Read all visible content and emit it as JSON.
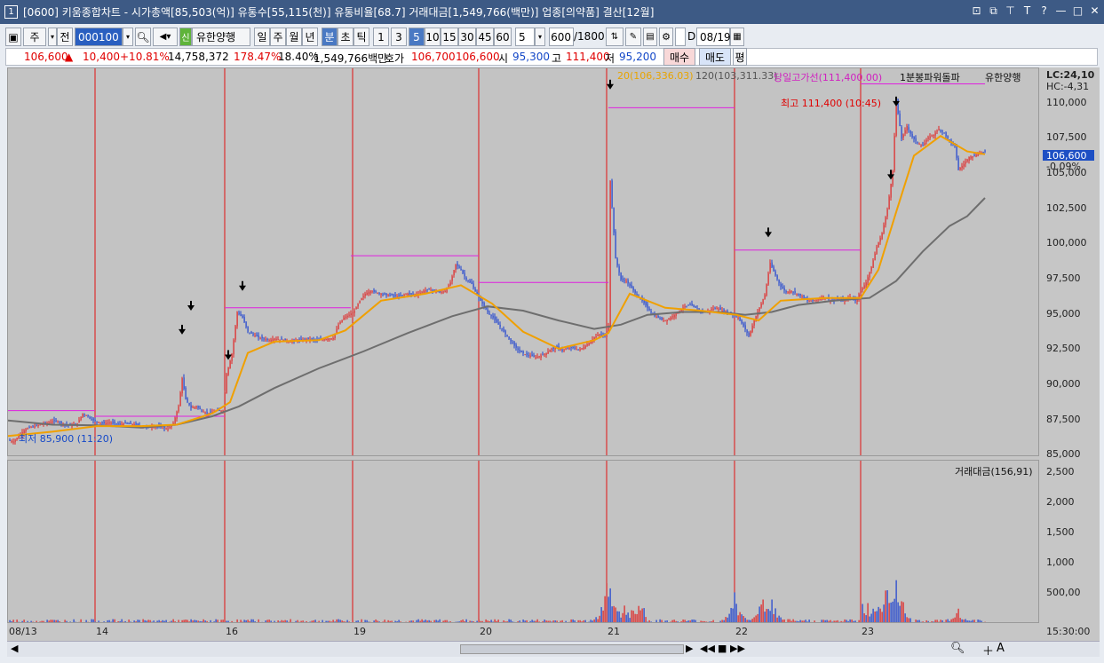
{
  "window": {
    "icon": "1",
    "title": "[0600] 키움종합차트 - 시가총액[85,503(억)] 유통수[55,115(천)] 유통비율[68.7] 거래대금[1,549,766(백만)] 업종[의약품] 결산[12월]",
    "buttons": [
      "⊡",
      "⧉",
      "⊤",
      "T",
      "?",
      "—",
      "□",
      "✕"
    ]
  },
  "toolbar": {
    "period": "주",
    "prev": "전",
    "code": "000100",
    "stock_name": "유한양행",
    "stock_badge": "신",
    "period_tabs": [
      "일",
      "주",
      "월",
      "년",
      "분",
      "초",
      "틱"
    ],
    "active_period": "분",
    "intervals": [
      "1",
      "3",
      "5",
      "10",
      "15",
      "30",
      "45",
      "60"
    ],
    "active_interval": "5",
    "interval_select": "5",
    "count": "600",
    "count_max": "/1800",
    "checkbox_label": "D",
    "date": "08/19"
  },
  "quote": {
    "price": "106,600",
    "arrow": "▲",
    "change": "10,400",
    "change_pct": "+10.81%",
    "volume": "14,758,372",
    "vol_ratio": "178.47%",
    "turnover": "18.40%",
    "amount": "1,549,766백만",
    "ask_label": "호가",
    "ask1": "106,700",
    "ask2": "106,600",
    "open_label": "시",
    "open": "95,300",
    "high_label": "고",
    "high": "111,400",
    "low_label": "저",
    "low": "95,200",
    "buy": "매수",
    "sell": "매도",
    "avg": "평"
  },
  "legend": {
    "ma20": "20(106,336.03)",
    "ma120": "120(103,311.33)",
    "high_line": "당일고가선(111,400.00)",
    "signal": "1분봉파워돌파",
    "name": "유한양행",
    "lc": "LC:24,10",
    "hc": "HC:-4,31",
    "max_note": "최고 111,400 (10:45)",
    "min_note": "최저 85,900 (11:20)",
    "volume": "거래대금(156,91)",
    "current_price": "106,600",
    "current_pct": "-0.09%"
  },
  "chart_data": {
    "type": "candlestick",
    "price_ticks": [
      "110,000",
      "107,500",
      "105,000",
      "102,500",
      "100,000",
      "97,500",
      "95,000",
      "92,500",
      "90,000",
      "87,500",
      "85,000"
    ],
    "price_values": [
      110000,
      107500,
      105000,
      102500,
      100000,
      97500,
      95000,
      92500,
      90000,
      87500,
      85000
    ],
    "ylim": [
      84900,
      112500
    ],
    "vol_ticks": [
      "2,500",
      "2,000",
      "1,500",
      "1,000",
      "500,00"
    ],
    "vol_values": [
      2500,
      2000,
      1500,
      1000,
      500
    ],
    "vol_lim": [
      0,
      2700
    ],
    "x_labels": [
      "08/13",
      "14",
      "16",
      "19",
      "20",
      "21",
      "22",
      "23"
    ],
    "time_label": "15:30:00",
    "close_series": [
      [
        0,
        86100
      ],
      [
        6,
        86000
      ],
      [
        12,
        86400
      ],
      [
        18,
        86800
      ],
      [
        24,
        87000
      ],
      [
        30,
        87100
      ],
      [
        36,
        87200
      ],
      [
        42,
        87300
      ],
      [
        48,
        87400
      ],
      [
        54,
        87500
      ],
      [
        60,
        87300
      ],
      [
        66,
        87200
      ],
      [
        72,
        87150
      ],
      [
        78,
        87300
      ],
      [
        84,
        88000
      ],
      [
        90,
        87800
      ],
      [
        96,
        87500
      ],
      [
        102,
        87400
      ],
      [
        108,
        87300
      ],
      [
        114,
        87350
      ],
      [
        120,
        87300
      ],
      [
        126,
        87200
      ],
      [
        132,
        87300
      ],
      [
        138,
        87250
      ],
      [
        144,
        87200
      ],
      [
        150,
        87100
      ],
      [
        156,
        87000
      ],
      [
        162,
        87100
      ],
      [
        168,
        87050
      ],
      [
        174,
        87000
      ],
      [
        180,
        86900
      ],
      [
        186,
        87300
      ],
      [
        192,
        88500
      ],
      [
        196,
        90500
      ],
      [
        200,
        89000
      ],
      [
        206,
        88400
      ],
      [
        212,
        88500
      ],
      [
        218,
        88200
      ],
      [
        224,
        88000
      ],
      [
        230,
        88100
      ],
      [
        236,
        88200
      ],
      [
        242,
        88200
      ],
      [
        246,
        90800
      ],
      [
        252,
        92200
      ],
      [
        258,
        95200
      ],
      [
        264,
        94800
      ],
      [
        270,
        93800
      ],
      [
        276,
        93600
      ],
      [
        282,
        93400
      ],
      [
        288,
        93300
      ],
      [
        294,
        93200
      ],
      [
        300,
        93300
      ],
      [
        306,
        93250
      ],
      [
        312,
        93200
      ],
      [
        318,
        93100
      ],
      [
        324,
        93200
      ],
      [
        330,
        93200
      ],
      [
        336,
        93300
      ],
      [
        342,
        93250
      ],
      [
        348,
        93200
      ],
      [
        354,
        93250
      ],
      [
        360,
        93300
      ],
      [
        366,
        93350
      ],
      [
        372,
        94300
      ],
      [
        378,
        94800
      ],
      [
        384,
        95000
      ],
      [
        390,
        95300
      ],
      [
        396,
        96000
      ],
      [
        402,
        96500
      ],
      [
        408,
        96700
      ],
      [
        414,
        96600
      ],
      [
        420,
        96500
      ],
      [
        426,
        96400
      ],
      [
        432,
        96400
      ],
      [
        438,
        96300
      ],
      [
        444,
        96400
      ],
      [
        450,
        96500
      ],
      [
        456,
        96450
      ],
      [
        462,
        96500
      ],
      [
        468,
        96700
      ],
      [
        474,
        96800
      ],
      [
        480,
        96700
      ],
      [
        486,
        96600
      ],
      [
        492,
        96700
      ],
      [
        498,
        97300
      ],
      [
        504,
        98600
      ],
      [
        510,
        98200
      ],
      [
        516,
        97500
      ],
      [
        522,
        97200
      ],
      [
        528,
        96400
      ],
      [
        534,
        95800
      ],
      [
        540,
        95200
      ],
      [
        546,
        94800
      ],
      [
        552,
        94300
      ],
      [
        558,
        93800
      ],
      [
        564,
        93300
      ],
      [
        570,
        92800
      ],
      [
        576,
        92400
      ],
      [
        582,
        92200
      ],
      [
        588,
        92100
      ],
      [
        594,
        92000
      ],
      [
        600,
        92100
      ],
      [
        606,
        92300
      ],
      [
        612,
        92600
      ],
      [
        618,
        92700
      ],
      [
        624,
        92500
      ],
      [
        630,
        92600
      ],
      [
        636,
        92700
      ],
      [
        642,
        92500
      ],
      [
        648,
        92700
      ],
      [
        654,
        93000
      ],
      [
        660,
        93400
      ],
      [
        666,
        93600
      ],
      [
        672,
        93500
      ],
      [
        676,
        94200
      ],
      [
        678,
        104500
      ],
      [
        684,
        99000
      ],
      [
        690,
        97500
      ],
      [
        696,
        97400
      ],
      [
        702,
        96900
      ],
      [
        708,
        96400
      ],
      [
        714,
        96000
      ],
      [
        720,
        95500
      ],
      [
        726,
        95000
      ],
      [
        732,
        94800
      ],
      [
        738,
        94600
      ],
      [
        744,
        94700
      ],
      [
        750,
        95000
      ],
      [
        756,
        95300
      ],
      [
        762,
        95600
      ],
      [
        768,
        95700
      ],
      [
        774,
        95500
      ],
      [
        780,
        95300
      ],
      [
        786,
        95200
      ],
      [
        792,
        95400
      ],
      [
        798,
        95500
      ],
      [
        804,
        95300
      ],
      [
        810,
        95200
      ],
      [
        816,
        95000
      ],
      [
        822,
        94800
      ],
      [
        828,
        94200
      ],
      [
        834,
        93500
      ],
      [
        840,
        94600
      ],
      [
        846,
        95500
      ],
      [
        852,
        96400
      ],
      [
        858,
        98700
      ],
      [
        864,
        97800
      ],
      [
        870,
        97000
      ],
      [
        876,
        96600
      ],
      [
        882,
        96700
      ],
      [
        888,
        96500
      ],
      [
        894,
        96300
      ],
      [
        900,
        96000
      ],
      [
        906,
        96000
      ],
      [
        912,
        96100
      ],
      [
        918,
        96300
      ],
      [
        924,
        96100
      ],
      [
        930,
        96000
      ],
      [
        936,
        96100
      ],
      [
        942,
        96000
      ],
      [
        948,
        96300
      ],
      [
        954,
        96000
      ],
      [
        960,
        96700
      ],
      [
        966,
        97300
      ],
      [
        972,
        98400
      ],
      [
        978,
        99800
      ],
      [
        984,
        100800
      ],
      [
        990,
        102500
      ],
      [
        996,
        105200
      ],
      [
        1000,
        110200
      ],
      [
        1006,
        107500
      ],
      [
        1012,
        108400
      ],
      [
        1018,
        107600
      ],
      [
        1024,
        107200
      ],
      [
        1030,
        107000
      ],
      [
        1036,
        107600
      ],
      [
        1042,
        107800
      ],
      [
        1048,
        108200
      ],
      [
        1054,
        107900
      ],
      [
        1060,
        107300
      ],
      [
        1066,
        107000
      ],
      [
        1070,
        105300
      ],
      [
        1076,
        105700
      ],
      [
        1082,
        106200
      ],
      [
        1088,
        106300
      ],
      [
        1094,
        106500
      ],
      [
        1100,
        106600
      ]
    ],
    "ma20": [
      [
        0,
        86400
      ],
      [
        50,
        86700
      ],
      [
        100,
        87100
      ],
      [
        150,
        87100
      ],
      [
        190,
        87200
      ],
      [
        230,
        88000
      ],
      [
        250,
        88800
      ],
      [
        270,
        92300
      ],
      [
        300,
        93100
      ],
      [
        350,
        93200
      ],
      [
        380,
        93900
      ],
      [
        420,
        96000
      ],
      [
        470,
        96500
      ],
      [
        510,
        97100
      ],
      [
        545,
        95800
      ],
      [
        580,
        93800
      ],
      [
        620,
        92600
      ],
      [
        660,
        93200
      ],
      [
        676,
        93700
      ],
      [
        700,
        96500
      ],
      [
        740,
        95500
      ],
      [
        780,
        95300
      ],
      [
        820,
        95000
      ],
      [
        845,
        94600
      ],
      [
        870,
        96000
      ],
      [
        920,
        96200
      ],
      [
        960,
        96200
      ],
      [
        980,
        98200
      ],
      [
        1000,
        102300
      ],
      [
        1020,
        106300
      ],
      [
        1050,
        107700
      ],
      [
        1080,
        106600
      ],
      [
        1100,
        106400
      ]
    ],
    "ma120": [
      [
        0,
        87500
      ],
      [
        50,
        87200
      ],
      [
        100,
        87150
      ],
      [
        150,
        87000
      ],
      [
        190,
        87200
      ],
      [
        230,
        87800
      ],
      [
        260,
        88500
      ],
      [
        300,
        89800
      ],
      [
        350,
        91200
      ],
      [
        400,
        92400
      ],
      [
        450,
        93700
      ],
      [
        500,
        94900
      ],
      [
        540,
        95600
      ],
      [
        580,
        95300
      ],
      [
        620,
        94600
      ],
      [
        660,
        94000
      ],
      [
        690,
        94300
      ],
      [
        720,
        95000
      ],
      [
        760,
        95200
      ],
      [
        800,
        95200
      ],
      [
        830,
        95000
      ],
      [
        860,
        95200
      ],
      [
        890,
        95700
      ],
      [
        930,
        96000
      ],
      [
        970,
        96200
      ],
      [
        1000,
        97400
      ],
      [
        1030,
        99500
      ],
      [
        1060,
        101300
      ],
      [
        1080,
        102000
      ],
      [
        1100,
        103300
      ]
    ],
    "day_highs": [
      [
        0,
        98,
        88200
      ],
      [
        98,
        244,
        87800
      ],
      [
        244,
        386,
        95500
      ],
      [
        386,
        530,
        99200
      ],
      [
        530,
        676,
        97300
      ],
      [
        676,
        818,
        109700
      ],
      [
        818,
        960,
        99600
      ],
      [
        960,
        1100,
        111400
      ]
    ],
    "arrows": [
      [
        196,
        93600
      ],
      [
        206,
        95300
      ],
      [
        248,
        91800
      ],
      [
        264,
        96700
      ],
      [
        678,
        111000
      ],
      [
        856,
        100500
      ],
      [
        994,
        104600
      ],
      [
        1000,
        109800
      ]
    ],
    "day_lines": [
      98,
      244,
      388,
      530,
      674,
      818,
      960
    ],
    "volume_bursts": [
      [
        676,
        900
      ],
      [
        990,
        820
      ],
      [
        1000,
        960
      ],
      [
        850,
        520
      ],
      [
        860,
        480
      ],
      [
        818,
        600
      ],
      [
        1070,
        300
      ]
    ]
  }
}
